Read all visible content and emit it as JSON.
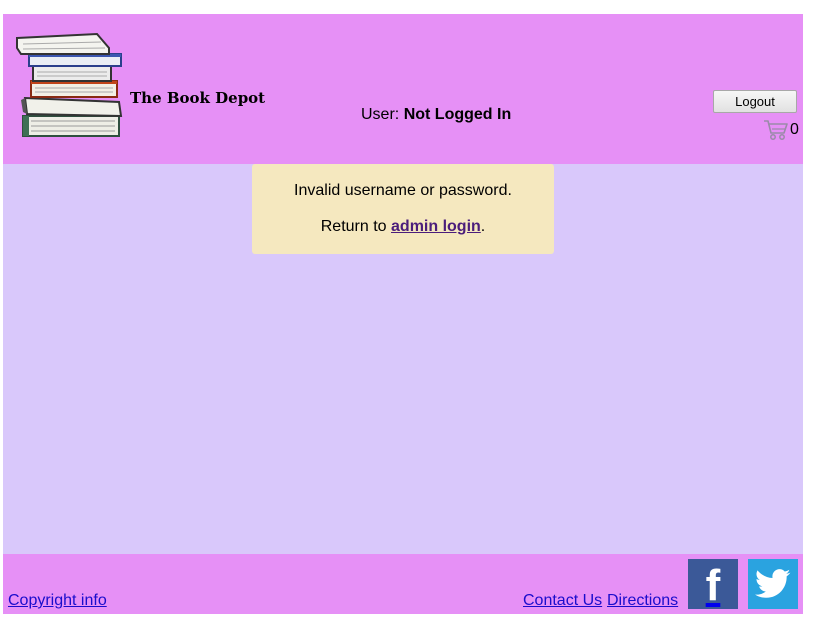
{
  "header": {
    "site_title": "The Book Depot",
    "user_label": "User:",
    "user_status": "Not Logged In",
    "logout_label": "Logout",
    "cart_count": "0",
    "cart_icon": "shopping-cart-icon"
  },
  "message": {
    "error": "Invalid username or password.",
    "return_prefix": "Return to ",
    "return_link": "admin login",
    "return_suffix": "."
  },
  "footer": {
    "copyright": "Copyright info",
    "contact": "Contact Us",
    "directions": "Directions",
    "facebook_icon": "facebook-icon",
    "twitter_icon": "twitter-icon"
  },
  "colors": {
    "header_bg": "#e690f6",
    "main_bg": "#d9c8fb",
    "message_bg": "#f5e8bf",
    "facebook": "#3b5998",
    "twitter": "#2aa3e0",
    "link": "#1a0dcc"
  }
}
